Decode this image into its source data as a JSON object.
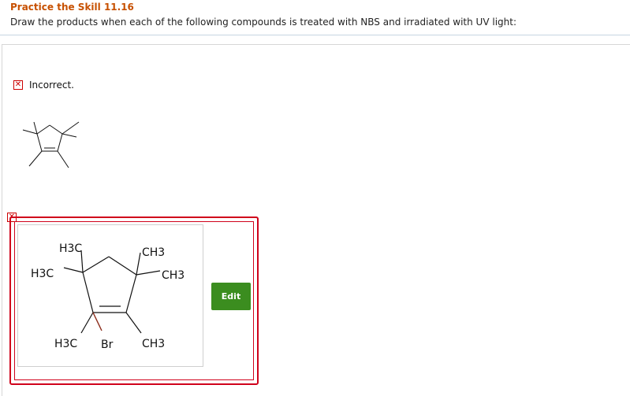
{
  "question": {
    "title": "Practice the Skill 11.16",
    "prompt": "Draw the products when each of the following compounds is treated with NBS and irradiated with UV light:"
  },
  "feedback": {
    "status_text": "Incorrect.",
    "status_icon": "x-mark-icon"
  },
  "answer": {
    "labels": {
      "h3c_top": "H3C",
      "h3c_left": "H3C",
      "ch3_top": "CH3",
      "ch3_right": "CH3",
      "h3c_bottom": "H3C",
      "br": "Br",
      "ch3_bottom": "CH3"
    },
    "edit_label": "Edit"
  },
  "colors": {
    "title": "#c75000",
    "error": "#d0021b",
    "edit_button": "#3b8d1f"
  }
}
